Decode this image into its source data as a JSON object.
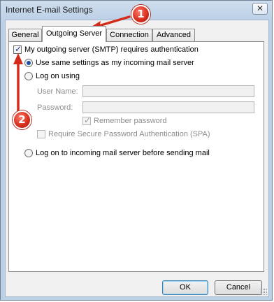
{
  "window": {
    "title": "Internet E-mail Settings",
    "close_glyph": "✕"
  },
  "tabs": [
    {
      "label": "General"
    },
    {
      "label": "Outgoing Server",
      "active": true
    },
    {
      "label": "Connection"
    },
    {
      "label": "Advanced"
    }
  ],
  "outgoing": {
    "smtp_auth_label": "My outgoing server (SMTP) requires authentication",
    "smtp_auth_checked": true,
    "same_settings_label": "Use same settings as my incoming mail server",
    "logon_using_label": "Log on using",
    "username_label": "User Name:",
    "username_value": "",
    "password_label": "Password:",
    "password_value": "",
    "remember_password_label": "Remember password",
    "spa_label": "Require Secure Password Authentication (SPA)",
    "logon_incoming_label": "Log on to incoming mail server before sending mail"
  },
  "buttons": {
    "ok": "OK",
    "cancel": "Cancel"
  },
  "annotations": {
    "badge_1": "1",
    "badge_2": "2",
    "color": "#d52b1a"
  }
}
